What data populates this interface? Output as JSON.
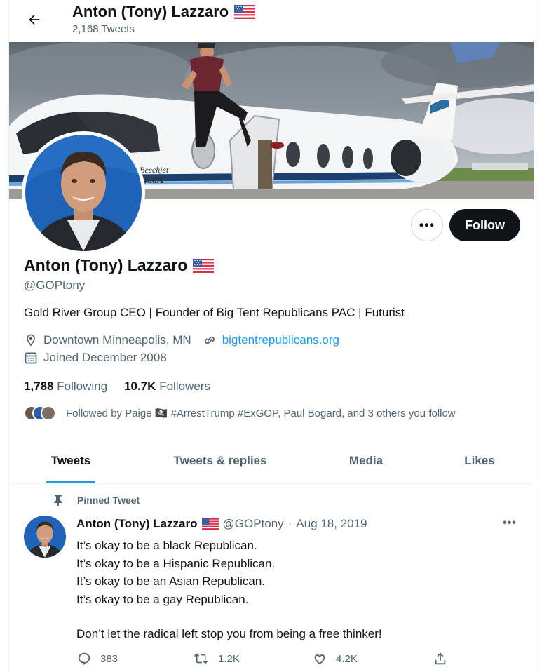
{
  "header": {
    "name": "Anton (Tony) Lazzaro",
    "tweet_count": "2,168 Tweets"
  },
  "profile": {
    "name": "Anton (Tony) Lazzaro",
    "handle": "@GOPtony",
    "bio": "Gold River Group CEO | Founder of Big Tent Republicans PAC | Futurist",
    "location": "Downtown Minneapolis, MN",
    "website": "bigtentrepublicans.org",
    "joined": "Joined December 2008",
    "following_count": "1,788",
    "following_label": "Following",
    "followers_count": "10.7K",
    "followers_label": "Followers",
    "followed_by": "Followed by Paige 🏴‍☠️ #ArrestTrump #ExGOP, Paul Bogard, and 3 others you follow",
    "follow_label": "Follow",
    "more_label": "•••"
  },
  "banner": {
    "plane_text_1": "Beechjet",
    "plane_text_2": "400A"
  },
  "tabs": [
    {
      "label": "Tweets"
    },
    {
      "label": "Tweets & replies"
    },
    {
      "label": "Media"
    },
    {
      "label": "Likes"
    }
  ],
  "tweet": {
    "pinned_label": "Pinned Tweet",
    "author": "Anton (Tony) Lazzaro",
    "handle": "@GOPtony",
    "sep": "·",
    "date": "Aug 18, 2019",
    "more_label": "•••",
    "lines": [
      "It’s okay to be a black Republican.",
      "It’s okay to be a Hispanic Republican.",
      "It’s okay to be an Asian Republican.",
      "It’s okay to be a gay Republican."
    ],
    "closing": "Don’t let the radical left stop you from being a free thinker!",
    "replies": "383",
    "retweets": "1.2K",
    "likes": "4.2K"
  },
  "colors": {
    "accent": "#1d9bf0",
    "text": "#0f1419",
    "secondary": "#536471"
  },
  "icons": [
    "back-arrow-icon",
    "us-flag-icon",
    "location-pin-icon",
    "link-icon",
    "calendar-icon",
    "pin-icon",
    "reply-icon",
    "retweet-icon",
    "like-icon",
    "share-icon"
  ]
}
